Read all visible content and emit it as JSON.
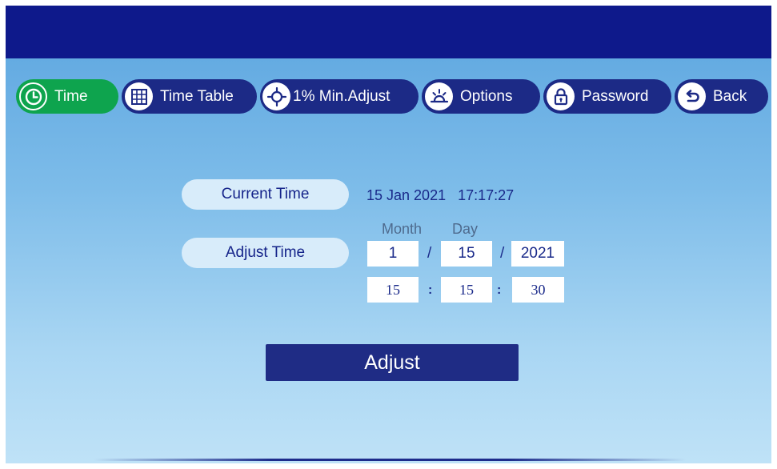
{
  "tabs": [
    {
      "label": "Time",
      "icon": "clock-icon",
      "active": true
    },
    {
      "label": "Time Table",
      "icon": "grid-icon",
      "active": false
    },
    {
      "label": "1% Min.Adjust",
      "icon": "crosshair-icon",
      "active": false
    },
    {
      "label": "Options",
      "icon": "sunrise-icon",
      "active": false
    },
    {
      "label": "Password",
      "icon": "lock-icon",
      "active": false
    },
    {
      "label": "Back",
      "icon": "back-arrow-icon",
      "active": false
    }
  ],
  "current_time": {
    "label": "Current Time",
    "date": "15 Jan 2021",
    "time": "17:17:27"
  },
  "adjust_time": {
    "label": "Adjust Time",
    "month_label": "Month",
    "day_label": "Day",
    "month": "1",
    "day": "15",
    "year": "2021",
    "date_sep": "/",
    "hour": "15",
    "minute": "15",
    "second": "30",
    "time_sep": ":"
  },
  "adjust_button": {
    "label": "Adjust"
  },
  "colors": {
    "topbar": "#0e198b",
    "tab_bg": "#1c2a86",
    "tab_active": "#0ea44e",
    "button": "#1f2c85"
  }
}
